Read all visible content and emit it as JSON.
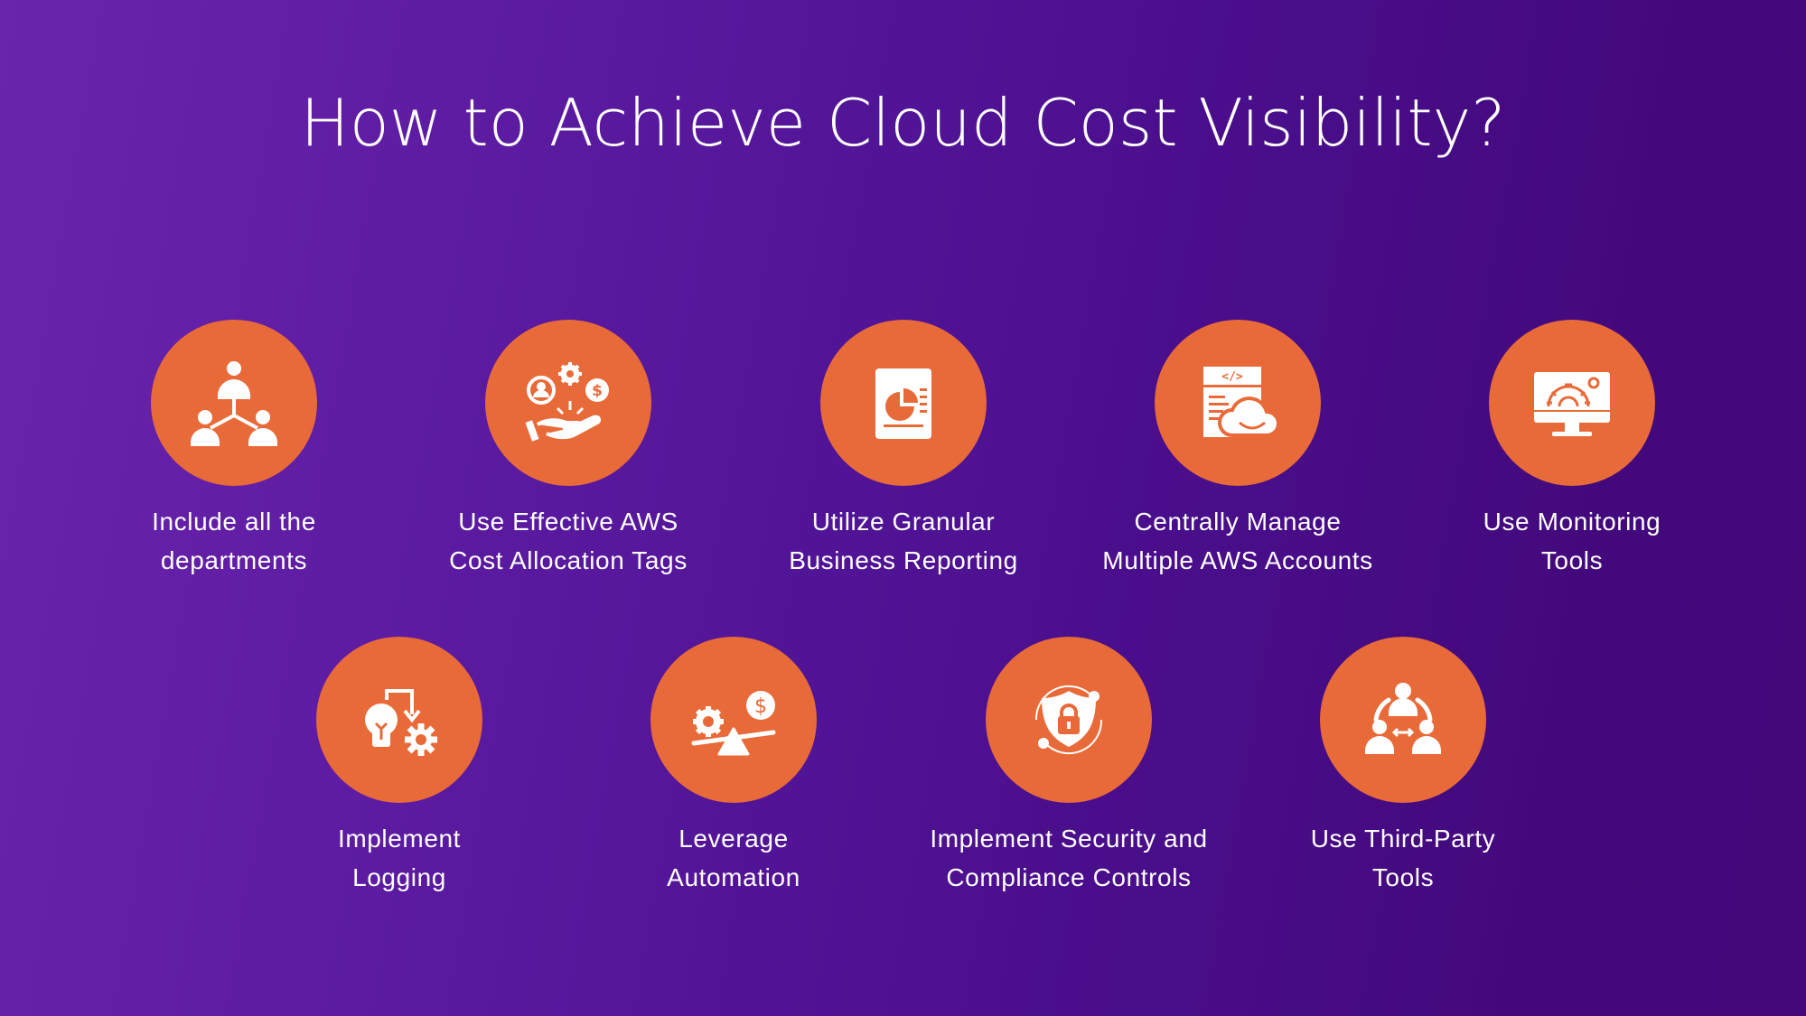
{
  "title": "How to Achieve Cloud Cost Visibility?",
  "colors": {
    "accent": "#e96a39",
    "background_left": "#6b24ad",
    "background_right": "#42087a",
    "text": "#ffffff"
  },
  "items": [
    {
      "icon": "org-people-icon",
      "line1": "Include all the",
      "line2": "departments"
    },
    {
      "icon": "hand-tags-icon",
      "line1": "Use Effective AWS",
      "line2": "Cost Allocation Tags"
    },
    {
      "icon": "report-chart-icon",
      "line1": "Utilize Granular",
      "line2": "Business Reporting"
    },
    {
      "icon": "code-cloud-icon",
      "line1": "Centrally Manage",
      "line2": "Multiple AWS Accounts"
    },
    {
      "icon": "monitor-gear-icon",
      "line1": "Use Monitoring",
      "line2": "Tools"
    },
    {
      "icon": "bulb-gear-icon",
      "line1": "Implement",
      "line2": "Logging"
    },
    {
      "icon": "balance-scale-icon",
      "line1": "Leverage",
      "line2": "Automation"
    },
    {
      "icon": "shield-lock-icon",
      "line1": "Implement Security and",
      "line2": "Compliance Controls"
    },
    {
      "icon": "team-exchange-icon",
      "line1": "Use Third-Party",
      "line2": "Tools"
    }
  ]
}
